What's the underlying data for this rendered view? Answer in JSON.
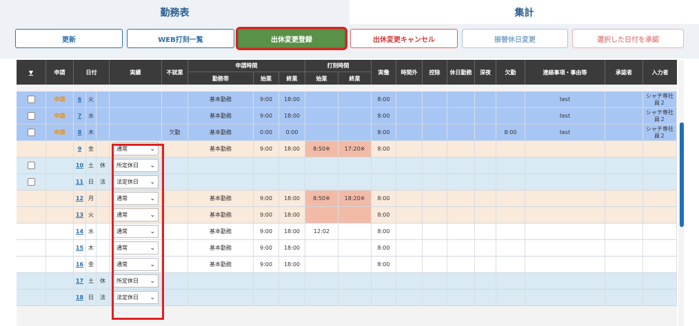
{
  "tabs": [
    "勤務表",
    "集計"
  ],
  "buttons": {
    "update": "更新",
    "web_punch": "WEB打刻一覧",
    "holiday_change_register": "出休変更登録",
    "holiday_change_cancel": "出休変更キャンセル",
    "substitute_change": "振替休日変更",
    "approve_selected": "選択した日付を承認"
  },
  "header": {
    "select": "▼",
    "apply": "申請",
    "date": "日付",
    "actual": "実績",
    "non_work": "不就業",
    "applied_time": "申請時間",
    "shift": "勤務帯",
    "start": "始業",
    "end": "終業",
    "punch_time": "打刻時間",
    "punch_start": "始業",
    "punch_end": "終業",
    "worked": "実働",
    "overtime": "時間外",
    "deduction": "控除",
    "holiday_work": "休日勤務",
    "late_night": "深夜",
    "absence": "欠勤",
    "notes": "連絡事項・事由等",
    "approver": "承認者",
    "entered_by": "入力者"
  },
  "rows": [
    {
      "check": true,
      "apply": "申請",
      "day": "6",
      "dow": "火",
      "hol": "",
      "actual": "",
      "nonwork": "",
      "shift": "基本勤務",
      "start": "9:00",
      "end": "18:00",
      "pstart": "",
      "pend": "",
      "worked": "8:00",
      "absence": "",
      "notes": "test",
      "entered": "シャチ専社員２"
    },
    {
      "check": true,
      "apply": "申請",
      "day": "7",
      "dow": "水",
      "hol": "",
      "actual": "",
      "nonwork": "",
      "shift": "基本勤務",
      "start": "9:00",
      "end": "18:00",
      "pstart": "",
      "pend": "",
      "worked": "8:00",
      "absence": "",
      "notes": "test",
      "entered": "シャチ専社員２"
    },
    {
      "check": true,
      "apply": "申請",
      "day": "8",
      "dow": "木",
      "hol": "",
      "actual": "",
      "nonwork": "欠勤",
      "shift": "基本勤務",
      "start": "0:00",
      "end": "0:00",
      "pstart": "",
      "pend": "",
      "worked": "8:00",
      "absence": "8:00",
      "notes": "test",
      "entered": "シャチ専社員２"
    },
    {
      "check": false,
      "apply": "",
      "day": "9",
      "dow": "金",
      "hol": "",
      "actual": "通常",
      "nonwork": "",
      "shift": "基本勤務",
      "start": "9:00",
      "end": "18:00",
      "pstart": "8:50※",
      "pend": "17:20※",
      "worked": "8:00",
      "absence": "",
      "notes": "",
      "entered": ""
    },
    {
      "check": true,
      "apply": "",
      "day": "10",
      "dow": "土",
      "hol": "休",
      "actual": "所定休日",
      "nonwork": "",
      "shift": "",
      "start": "",
      "end": "",
      "pstart": "",
      "pend": "",
      "worked": "",
      "absence": "",
      "notes": "",
      "entered": ""
    },
    {
      "check": true,
      "apply": "",
      "day": "11",
      "dow": "日",
      "hol": "法",
      "actual": "法定休日",
      "nonwork": "",
      "shift": "",
      "start": "",
      "end": "",
      "pstart": "",
      "pend": "",
      "worked": "",
      "absence": "",
      "notes": "",
      "entered": ""
    },
    {
      "check": false,
      "apply": "",
      "day": "12",
      "dow": "月",
      "hol": "",
      "actual": "通常",
      "nonwork": "",
      "shift": "基本勤務",
      "start": "9:00",
      "end": "18:00",
      "pstart": "8:50※",
      "pend": "18:20※",
      "worked": "8:00",
      "absence": "",
      "notes": "",
      "entered": ""
    },
    {
      "check": false,
      "apply": "",
      "day": "13",
      "dow": "火",
      "hol": "",
      "actual": "通常",
      "nonwork": "",
      "shift": "基本勤務",
      "start": "9:00",
      "end": "18:00",
      "pstart": "",
      "pend": "",
      "worked": "8:00",
      "absence": "",
      "notes": "",
      "entered": ""
    },
    {
      "check": false,
      "apply": "",
      "day": "14",
      "dow": "水",
      "hol": "",
      "actual": "通常",
      "nonwork": "",
      "shift": "基本勤務",
      "start": "9:00",
      "end": "18:00",
      "pstart": "12:02",
      "pend": "",
      "worked": "8:00",
      "absence": "",
      "notes": "",
      "entered": ""
    },
    {
      "check": false,
      "apply": "",
      "day": "15",
      "dow": "木",
      "hol": "",
      "actual": "通常",
      "nonwork": "",
      "shift": "基本勤務",
      "start": "9:00",
      "end": "18:00",
      "pstart": "",
      "pend": "",
      "worked": "8:00",
      "absence": "",
      "notes": "",
      "entered": ""
    },
    {
      "check": false,
      "apply": "",
      "day": "16",
      "dow": "金",
      "hol": "",
      "actual": "通常",
      "nonwork": "",
      "shift": "基本勤務",
      "start": "9:00",
      "end": "18:00",
      "pstart": "",
      "pend": "",
      "worked": "8:00",
      "absence": "",
      "notes": "",
      "entered": ""
    },
    {
      "check": false,
      "apply": "",
      "day": "17",
      "dow": "土",
      "hol": "休",
      "actual": "所定休日",
      "nonwork": "",
      "shift": "",
      "start": "",
      "end": "",
      "pstart": "",
      "pend": "",
      "worked": "",
      "absence": "",
      "notes": "",
      "entered": ""
    },
    {
      "check": false,
      "apply": "",
      "day": "18",
      "dow": "日",
      "hol": "法",
      "actual": "法定休日",
      "nonwork": "",
      "shift": "",
      "start": "",
      "end": "",
      "pstart": "",
      "pend": "",
      "worked": "",
      "absence": "",
      "notes": "",
      "entered": ""
    }
  ],
  "colors": {
    "applied_row": "#a8c6f4",
    "pending_row": "#faeadb",
    "holiday_row": "#d9eaf4",
    "normal_row": "#ffffff",
    "punch_highlight": "#f1bba8",
    "highlight_border": "#e02020"
  }
}
